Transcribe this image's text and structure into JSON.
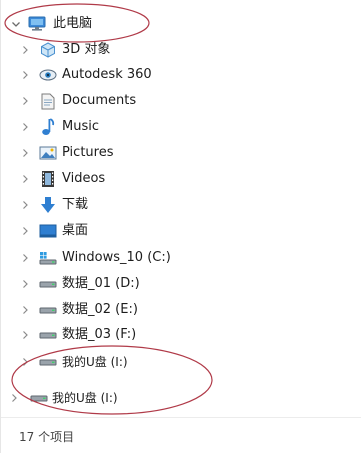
{
  "tree": {
    "root": {
      "label": "此电脑",
      "icon": "monitor-icon"
    },
    "items": [
      {
        "label": "3D 对象",
        "icon": "cube-3d-icon"
      },
      {
        "label": "Autodesk 360",
        "icon": "cloud-eye-icon"
      },
      {
        "label": "Documents",
        "icon": "document-icon"
      },
      {
        "label": "Music",
        "icon": "music-note-icon"
      },
      {
        "label": "Pictures",
        "icon": "picture-icon"
      },
      {
        "label": "Videos",
        "icon": "film-icon"
      },
      {
        "label": "下载",
        "icon": "download-arrow-icon"
      },
      {
        "label": "桌面",
        "icon": "desktop-icon"
      },
      {
        "label": "Windows_10 (C:)",
        "icon": "system-drive-icon"
      },
      {
        "label": "数据_01 (D:)",
        "icon": "drive-icon"
      },
      {
        "label": "数据_02 (E:)",
        "icon": "drive-icon"
      },
      {
        "label": "数据_03 (F:)",
        "icon": "drive-icon"
      },
      {
        "label": "我的U盘 (I:)",
        "icon": "usb-drive-icon"
      }
    ],
    "detached": {
      "label": "我的U盘 (I:)",
      "icon": "usb-drive-icon"
    }
  },
  "status_bar": {
    "item_count": "17 个项目"
  },
  "colors": {
    "annotation": "#b03a48",
    "folder_blue": "#2f7fd1",
    "chevron": "#8a8a8a"
  }
}
